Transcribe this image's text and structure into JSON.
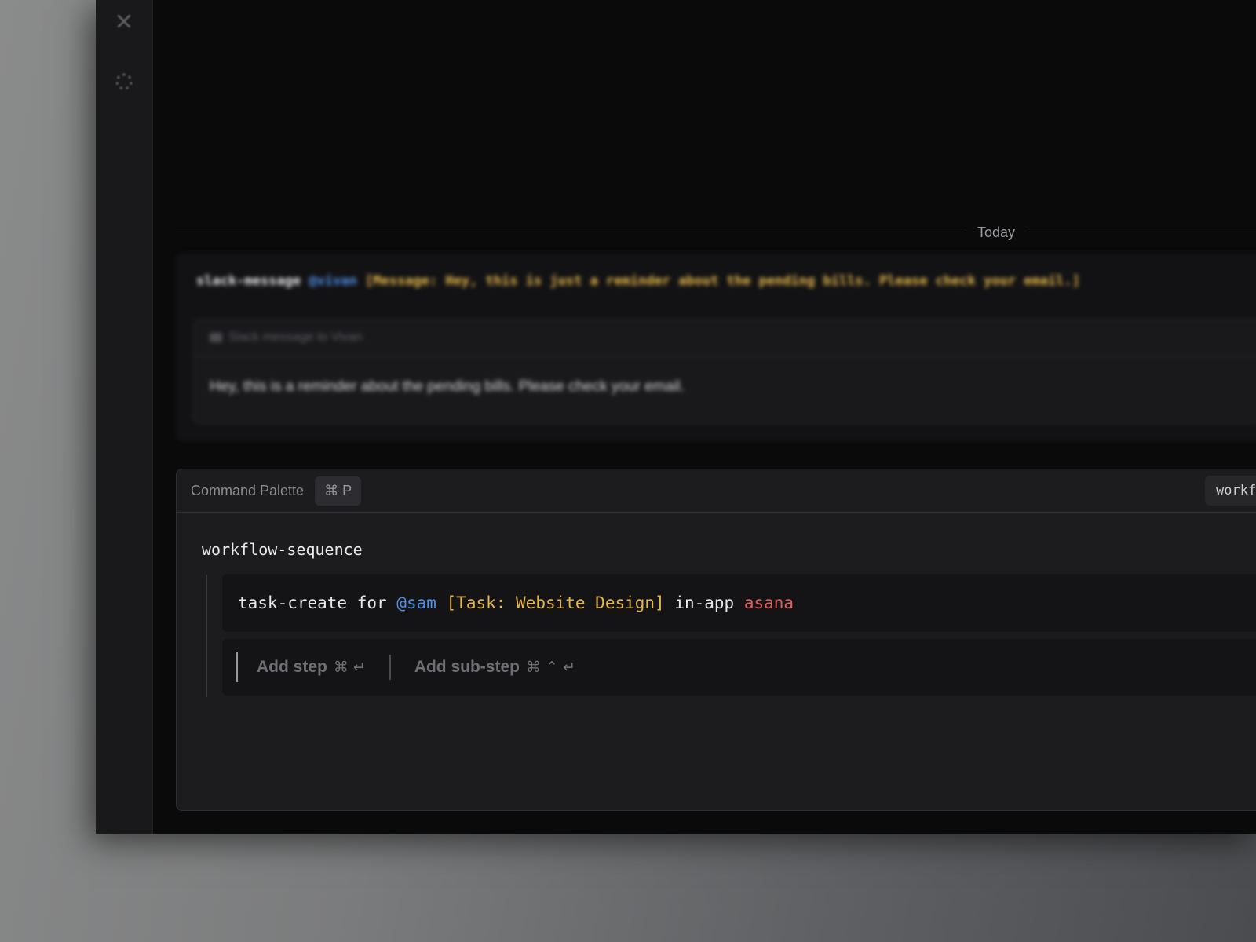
{
  "sidebar": {
    "icons": [
      "tools-icon",
      "gear-icon"
    ]
  },
  "timeline": {
    "divider_label": "Today"
  },
  "history_message": {
    "command": "slack-message",
    "mention": "@vivan",
    "payload": "[Message: Hey, this is just a reminder about the pending bills. Please check your email.]",
    "preview_title": "Slack message to Vivan",
    "preview_body": "Hey, this is a reminder about the pending bills. Please check your email."
  },
  "palette": {
    "title": "Command Palette",
    "shortcut": "⌘ P",
    "mode_chip": "workf",
    "sequence_title": "workflow-sequence",
    "step": {
      "command": "task-create for ",
      "mention": "@sam",
      "task": "[Task: Website Design]",
      "mid": " in-app ",
      "app": "asana"
    },
    "add_step": {
      "label": "Add step",
      "keys": "⌘ ↵"
    },
    "add_substep": {
      "label": "Add sub-step",
      "keys": "⌘ ⌃ ↵"
    }
  },
  "colors": {
    "mention": "#4f8fe6",
    "task": "#e6b84a",
    "app": "#e0605c",
    "background": "#0a0a0b"
  }
}
